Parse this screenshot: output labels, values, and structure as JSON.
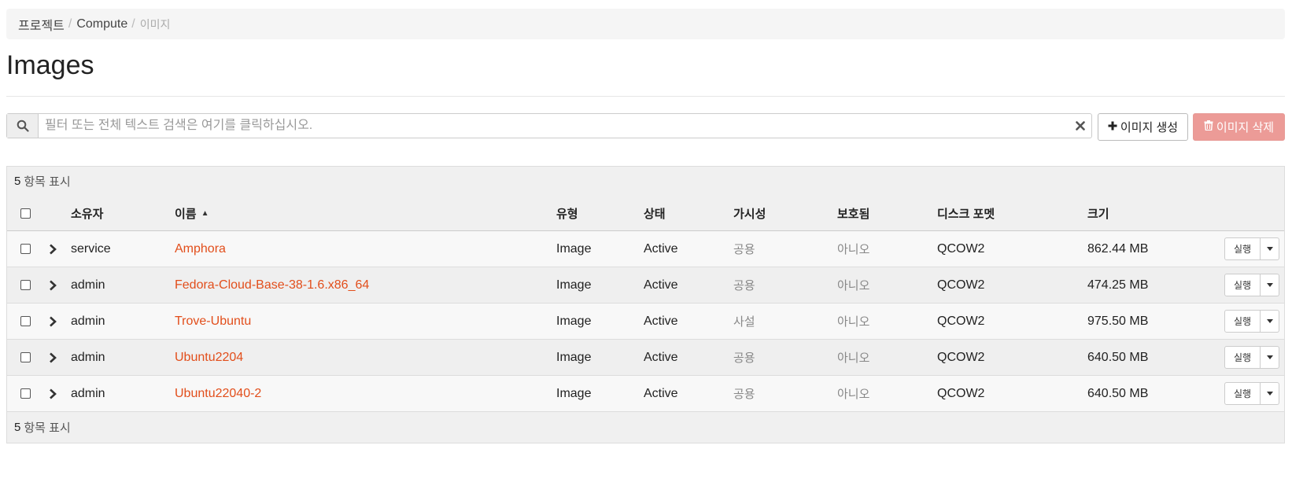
{
  "breadcrumb": [
    {
      "label": "프로젝트"
    },
    {
      "label": "Compute"
    },
    {
      "label": "이미지"
    }
  ],
  "breadcrumb_separator": "/",
  "page_title": "Images",
  "search": {
    "placeholder": "필터 또는 전체 텍스트 검색은 여기를 클릭하십시오.",
    "value": "",
    "search_icon": "search-icon",
    "clear_icon": "close-icon"
  },
  "actions": {
    "create_label": "이미지 생성",
    "create_icon": "plus-icon",
    "delete_label": "이미지 삭제",
    "delete_icon": "trash-icon"
  },
  "summary": {
    "count": "5",
    "label": "항목 표시"
  },
  "columns": {
    "owner": "소유자",
    "name": "이름",
    "type": "유형",
    "status": "상태",
    "visibility": "가시성",
    "protected": "보호됨",
    "disk_format": "디스크 포멧",
    "size": "크기"
  },
  "sort": {
    "column": "name",
    "direction": "ascending"
  },
  "rows": [
    {
      "owner": "service",
      "name": "Amphora",
      "type": "Image",
      "status": "Active",
      "visibility": "공용",
      "protected": "아니오",
      "disk_format": "QCOW2",
      "size": "862.44 MB",
      "action": "실행"
    },
    {
      "owner": "admin",
      "name": "Fedora-Cloud-Base-38-1.6.x86_64",
      "type": "Image",
      "status": "Active",
      "visibility": "공용",
      "protected": "아니오",
      "disk_format": "QCOW2",
      "size": "474.25 MB",
      "action": "실행"
    },
    {
      "owner": "admin",
      "name": "Trove-Ubuntu",
      "type": "Image",
      "status": "Active",
      "visibility": "사설",
      "protected": "아니오",
      "disk_format": "QCOW2",
      "size": "975.50 MB",
      "action": "실행"
    },
    {
      "owner": "admin",
      "name": "Ubuntu2204",
      "type": "Image",
      "status": "Active",
      "visibility": "공용",
      "protected": "아니오",
      "disk_format": "QCOW2",
      "size": "640.50 MB",
      "action": "실행"
    },
    {
      "owner": "admin",
      "name": "Ubuntu22040-2",
      "type": "Image",
      "status": "Active",
      "visibility": "공용",
      "protected": "아니오",
      "disk_format": "QCOW2",
      "size": "640.50 MB",
      "action": "실행"
    }
  ],
  "colors": {
    "link": "#e24e1b",
    "danger_button": "#ec9b97",
    "header_bg": "#f0f0f0"
  }
}
